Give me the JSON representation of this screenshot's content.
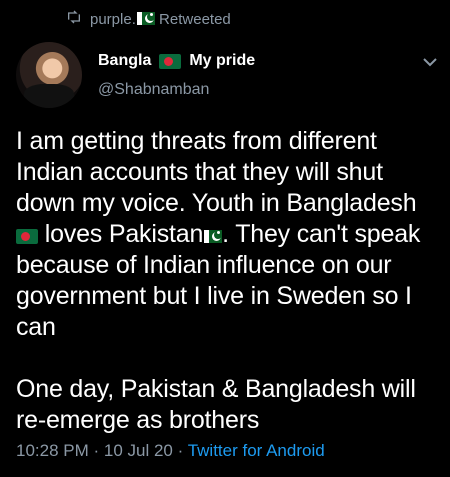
{
  "retweet": {
    "user": "purple.",
    "label": "Retweeted"
  },
  "author": {
    "name_part1": "Bangla",
    "name_part2": "My pride",
    "handle": "@Shabnamban"
  },
  "tweet": {
    "line1": "I am getting threats from different",
    "line2": "Indian accounts that they will shut",
    "line3": "down my voice. Youth in Bangladesh",
    "line4a": "loves Pakistan",
    "line4b": ". They can't speak",
    "line5": "because of Indian influence on our",
    "line6": "government but I live in Sweden so I",
    "line7": "can",
    "line8": "One day, Pakistan & Bangladesh will",
    "line9": "re-emerge as brothers"
  },
  "meta": {
    "time": "10:28 PM",
    "sep1": " · ",
    "date": "10 Jul 20",
    "sep2": " · ",
    "source": "Twitter for Android"
  },
  "colors": {
    "background": "#000000",
    "text": "#ffffff",
    "muted": "#8b98a5",
    "link": "#1d9bf0"
  }
}
